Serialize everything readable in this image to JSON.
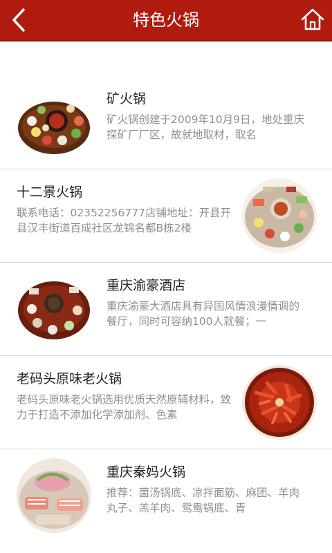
{
  "header": {
    "title": "特色火锅",
    "back_icon": "chevron-left-icon",
    "home_icon": "home-icon",
    "color": "#b01b10"
  },
  "items": [
    {
      "name": "矿火锅",
      "desc": "矿火锅创建于2009年10月9日，地处重庆探矿厂厂区，故就地取材，取名",
      "image_side": "left"
    },
    {
      "name": "十二景火锅",
      "desc": "联系电话：02352256777店铺地址：开县开县汉丰街道百成社区龙锦名都B栋2楼",
      "image_side": "right"
    },
    {
      "name": "重庆渝豪酒店",
      "desc": "重庆渝豪大酒店具有异国风情浪漫情调的餐厅，同时可容纳100人就餐；一",
      "image_side": "left"
    },
    {
      "name": "老码头原味老火锅",
      "desc": "老码头原味老火锅选用优质天然原辅材料，致力于打造不添加化学添加剂、色素",
      "image_side": "right"
    },
    {
      "name": "重庆秦妈火锅",
      "desc": "推荐：菌汤锅底、凉拌面筋、麻团、羊肉丸子、羔羊肉、鸳鸯锅底、青",
      "image_side": "left"
    }
  ]
}
